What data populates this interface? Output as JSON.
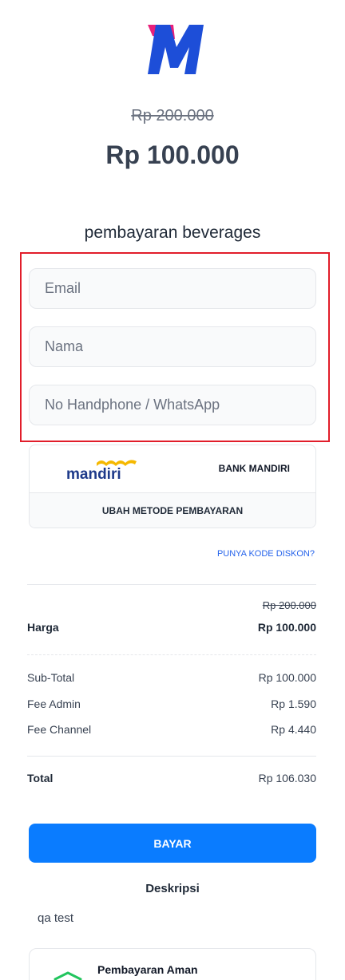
{
  "brand": {
    "logo_icon": "m-logo-icon",
    "accent_pink": "#e8207a",
    "accent_blue": "#1d4ed8"
  },
  "price": {
    "original": "Rp 200.000",
    "current": "Rp 100.000"
  },
  "product": {
    "title": "pembayaran beverages"
  },
  "form": {
    "email_placeholder": "Email",
    "name_placeholder": "Nama",
    "phone_placeholder": "No Handphone / WhatsApp",
    "highlight_color": "#e11d2a"
  },
  "payment_method": {
    "logo_text": "mandiri",
    "bank_name": "BANK MANDIRI",
    "change_label": "UBAH METODE PEMBAYARAN"
  },
  "discount": {
    "link_label": "PUNYA KODE DISKON?"
  },
  "summary": {
    "harga_original": "Rp 200.000",
    "harga_label": "Harga",
    "harga_value": "Rp 100.000",
    "subtotal_label": "Sub-Total",
    "subtotal_value": "Rp 100.000",
    "fee_admin_label": "Fee Admin",
    "fee_admin_value": "Rp 1.590",
    "fee_channel_label": "Fee Channel",
    "fee_channel_value": "Rp 4.440",
    "total_label": "Total",
    "total_value": "Rp 106.030"
  },
  "actions": {
    "pay_label": "BAYAR",
    "pay_color": "#0a7cff"
  },
  "description": {
    "title": "Deskripsi",
    "text": "qa test"
  },
  "secure": {
    "title": "Pembayaran Aman",
    "icon": "shield-check-icon"
  }
}
